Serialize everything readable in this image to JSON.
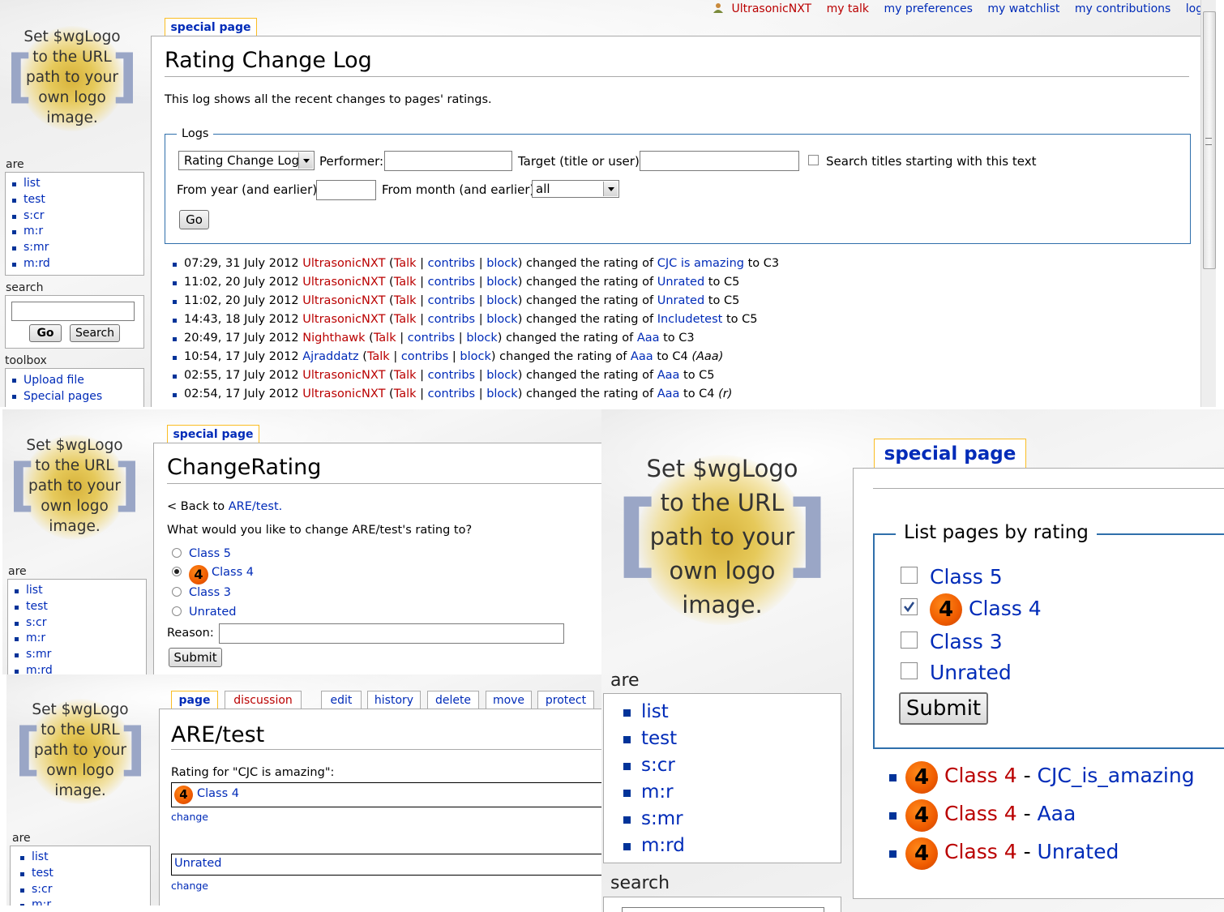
{
  "logo_text": [
    "Set $wgLogo",
    "to the URL",
    "path to your",
    "own logo",
    "image."
  ],
  "usernav": {
    "user": "UltrasonicNXT",
    "talk": "my talk",
    "prefs": "my preferences",
    "watchlist": "my watchlist",
    "contribs": "my contributions",
    "logout": "log out"
  },
  "sidebar": {
    "are_heading": "are",
    "are_items": [
      "list",
      "test",
      "s:cr",
      "m:r",
      "s:mr",
      "m:rd"
    ],
    "search_heading": "search",
    "go_btn": "Go",
    "search_btn": "Search",
    "toolbox_heading": "toolbox",
    "toolbox_items": [
      "Upload file",
      "Special pages"
    ]
  },
  "panel1": {
    "tab": "special page",
    "title": "Rating Change Log",
    "intro": "This log shows all the recent changes to pages' ratings.",
    "legend": "Logs",
    "log_select": "Rating Change Log",
    "performer_label": "Performer:",
    "target_label": "Target (title or user):",
    "prefix_label": "Search titles starting with this text",
    "year_label": "From year (and earlier):",
    "month_label": "From month (and earlier):",
    "month_value": "all",
    "go_btn": "Go",
    "entries": [
      {
        "time": "07:29, 31 July 2012",
        "user": "UltrasonicNXT",
        "user_red": true,
        "talk": "Talk",
        "contribs": "contribs",
        "block": "block",
        "action": "changed the rating of",
        "page": "CJC is amazing",
        "to": "to C3",
        "note": ""
      },
      {
        "time": "11:02, 20 July 2012",
        "user": "UltrasonicNXT",
        "user_red": true,
        "talk": "Talk",
        "contribs": "contribs",
        "block": "block",
        "action": "changed the rating of",
        "page": "Unrated",
        "to": "to C5",
        "note": ""
      },
      {
        "time": "11:02, 20 July 2012",
        "user": "UltrasonicNXT",
        "user_red": true,
        "talk": "Talk",
        "contribs": "contribs",
        "block": "block",
        "action": "changed the rating of",
        "page": "Unrated",
        "to": "to C5",
        "note": ""
      },
      {
        "time": "14:43, 18 July 2012",
        "user": "UltrasonicNXT",
        "user_red": true,
        "talk": "Talk",
        "contribs": "contribs",
        "block": "block",
        "action": "changed the rating of",
        "page": "Includetest",
        "to": "to C5",
        "note": ""
      },
      {
        "time": "20:49, 17 July 2012",
        "user": "Nighthawk",
        "user_red": true,
        "talk": "Talk",
        "contribs": "contribs",
        "block": "block",
        "action": "changed the rating of",
        "page": "Aaa",
        "to": "to C3",
        "note": ""
      },
      {
        "time": "10:54, 17 July 2012",
        "user": "Ajraddatz",
        "user_red": false,
        "talk": "Talk",
        "contribs": "contribs",
        "block": "block",
        "action": "changed the rating of",
        "page": "Aaa",
        "to": "to C4",
        "note": "(Aaa)"
      },
      {
        "time": "02:55, 17 July 2012",
        "user": "UltrasonicNXT",
        "user_red": true,
        "talk": "Talk",
        "contribs": "contribs",
        "block": "block",
        "action": "changed the rating of",
        "page": "Aaa",
        "to": "to C5",
        "note": ""
      },
      {
        "time": "02:54, 17 July 2012",
        "user": "UltrasonicNXT",
        "user_red": true,
        "talk": "Talk",
        "contribs": "contribs",
        "block": "block",
        "action": "changed the rating of",
        "page": "Aaa",
        "to": "to C4",
        "note": "(r)"
      }
    ]
  },
  "panel2": {
    "tab": "special page",
    "title": "ChangeRating",
    "back_prefix": "< Back to",
    "back_link": "ARE/test.",
    "question": "What would you like to change ARE/test's rating to?",
    "options": [
      "Class 5",
      "Class 4",
      "Class 3",
      "Unrated"
    ],
    "selected": 1,
    "badge": "4",
    "reason_label": "Reason:",
    "submit": "Submit"
  },
  "panel3": {
    "tabs": [
      "page",
      "discussion",
      "edit",
      "history",
      "delete",
      "move",
      "protect"
    ],
    "title": "ARE/test",
    "rating_for": "Rating for \"CJC is amazing\":",
    "box1_badge": "4",
    "box1_text": "Class 4",
    "change1": "change",
    "box2_text": "Unrated",
    "change2": "change"
  },
  "panel4": {
    "tab": "special page",
    "legend": "List pages by rating",
    "options": [
      "Class 5",
      "Class 4",
      "Class 3",
      "Unrated"
    ],
    "checked": [
      false,
      true,
      false,
      false
    ],
    "badge": "4",
    "submit": "Submit",
    "results": [
      {
        "class": "Class 4",
        "sep": " - ",
        "page": "CJC_is_amazing"
      },
      {
        "class": "Class 4",
        "sep": " - ",
        "page": "Aaa"
      },
      {
        "class": "Class 4",
        "sep": " - ",
        "page": "Unrated"
      }
    ],
    "are_heading": "are",
    "are_items": [
      "list",
      "test",
      "s:cr",
      "m:r",
      "s:mr",
      "m:rd"
    ],
    "search_heading": "search"
  }
}
